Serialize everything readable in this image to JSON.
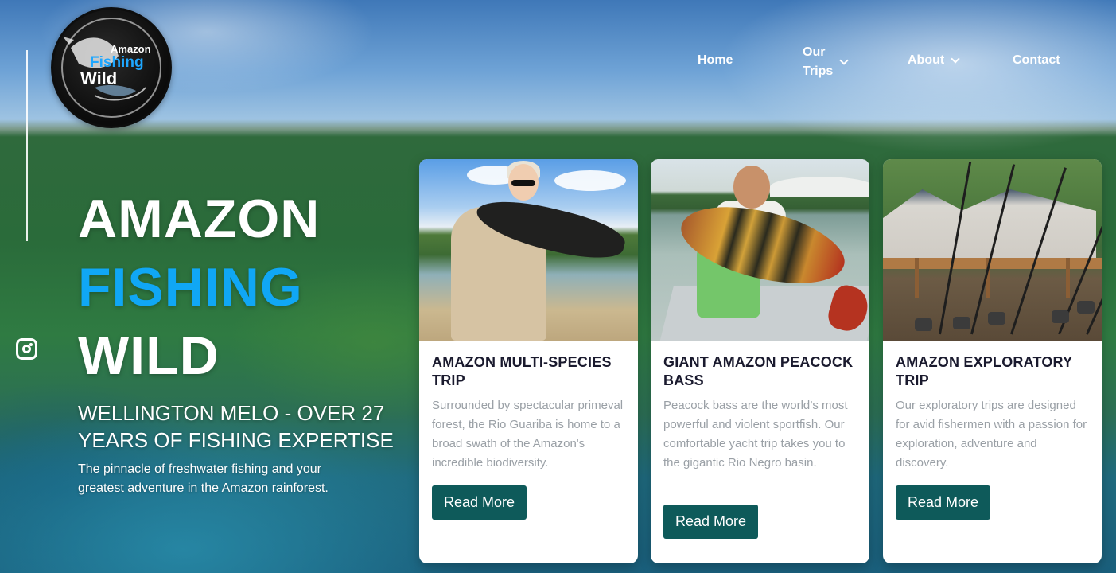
{
  "logo": {
    "line1": "Amazon",
    "line2": "Fishing",
    "line3": "Wild"
  },
  "nav": {
    "home": "Home",
    "trips_line1": "Our",
    "trips_line2": "Trips",
    "about": "About",
    "contact": "Contact"
  },
  "hero": {
    "title_line1": "AMAZON",
    "title_line2": "FISHING",
    "title_line3": "WILD",
    "subtitle": "WELLINGTON MELO - OVER 27 YEARS OF FISHING EXPERTISE",
    "tagline": "The pinnacle of freshwater fishing and your greatest adventure in the Amazon rainforest."
  },
  "cards": [
    {
      "title": "AMAZON MULTI-SPECIES TRIP",
      "description": "Surrounded by spectacular primeval forest, the Rio Guariba is home to a broad swath of the Amazon's incredible biodiversity.",
      "button": "Read More"
    },
    {
      "title": "GIANT AMAZON PEACOCK BASS",
      "description": "Peacock bass are the world’s most powerful and violent sportfish. Our comfortable yacht trip takes you to the gigantic Rio Negro basin.",
      "button": "Read More"
    },
    {
      "title": "AMAZON EXPLORATORY TRIP",
      "description": "Our exploratory trips are designed for avid fishermen with a passion for exploration, adventure and discovery.",
      "button": "Read More"
    }
  ],
  "icons": {
    "social": "instagram-icon",
    "dropdown": "chevron-down-icon"
  },
  "colors": {
    "accent": "#10a7f5",
    "button": "#0e5a5a",
    "card_title": "#1a1a2e",
    "card_text": "#9aa0a6"
  }
}
